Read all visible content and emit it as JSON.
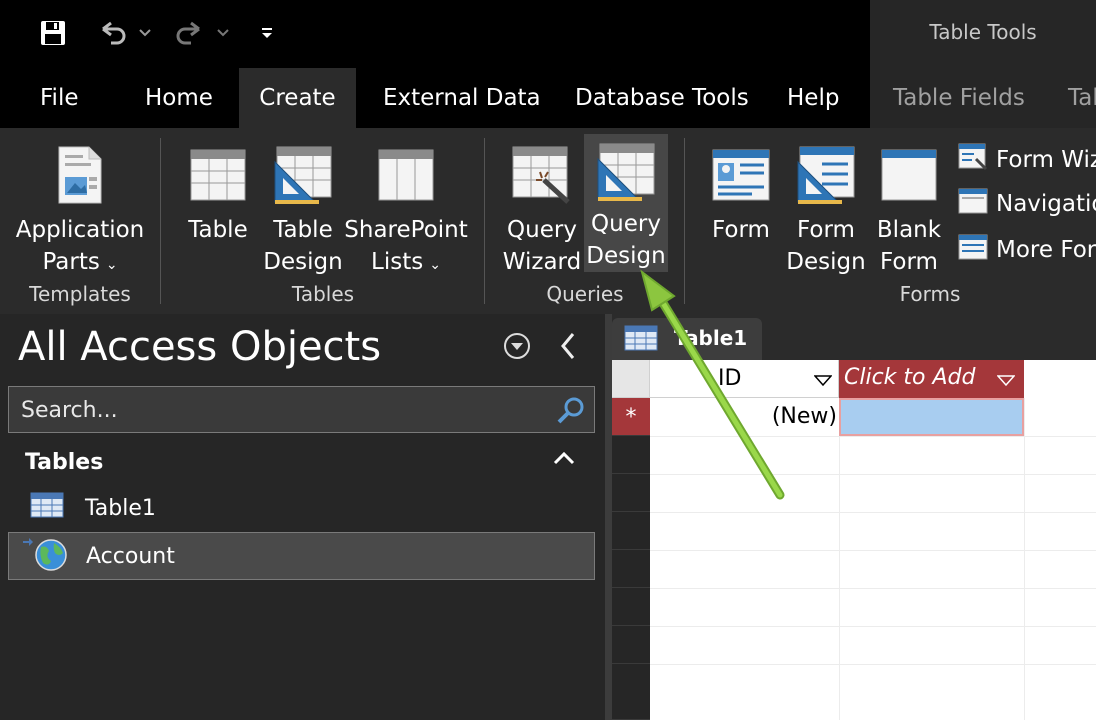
{
  "qat": {
    "save": "save-icon",
    "undo": "undo-icon",
    "redo": "redo-icon",
    "customize": "customize-icon"
  },
  "contextual": {
    "label": "Table Tools"
  },
  "tabs": [
    {
      "label": "File"
    },
    {
      "label": "Home"
    },
    {
      "label": "Create"
    },
    {
      "label": "External Data"
    },
    {
      "label": "Database Tools"
    },
    {
      "label": "Help"
    },
    {
      "label": "Table Fields"
    },
    {
      "label": "Tab"
    }
  ],
  "ribbon": {
    "templates": {
      "application_parts_line1": "Application",
      "application_parts_line2": "Parts",
      "group": "Templates"
    },
    "tables": {
      "table": "Table",
      "table_design_line1": "Table",
      "table_design_line2": "Design",
      "sharepoint_line1": "SharePoint",
      "sharepoint_line2": "Lists",
      "group": "Tables"
    },
    "queries": {
      "wizard_line1": "Query",
      "wizard_line2": "Wizard",
      "design_line1": "Query",
      "design_line2": "Design",
      "group": "Queries"
    },
    "forms": {
      "form": "Form",
      "form_design_line1": "Form",
      "form_design_line2": "Design",
      "blank_line1": "Blank",
      "blank_line2": "Form",
      "form_wizard": "Form Wiz",
      "navigation": "Navigatio",
      "more_forms": "More For",
      "group": "Forms"
    }
  },
  "nav": {
    "title": "All Access Objects",
    "search_placeholder": "Search...",
    "group_tables": "Tables",
    "items": [
      {
        "label": "Table1"
      },
      {
        "label": "Account"
      }
    ]
  },
  "document": {
    "tab_label": "Table1",
    "columns": [
      {
        "label": "ID"
      },
      {
        "label": "Click to Add"
      }
    ],
    "new_row_value": "(New)"
  },
  "colors": {
    "accent": "#a4373a",
    "annotation_arrow": "#8cc63f",
    "selection": "#a8cdf0"
  }
}
